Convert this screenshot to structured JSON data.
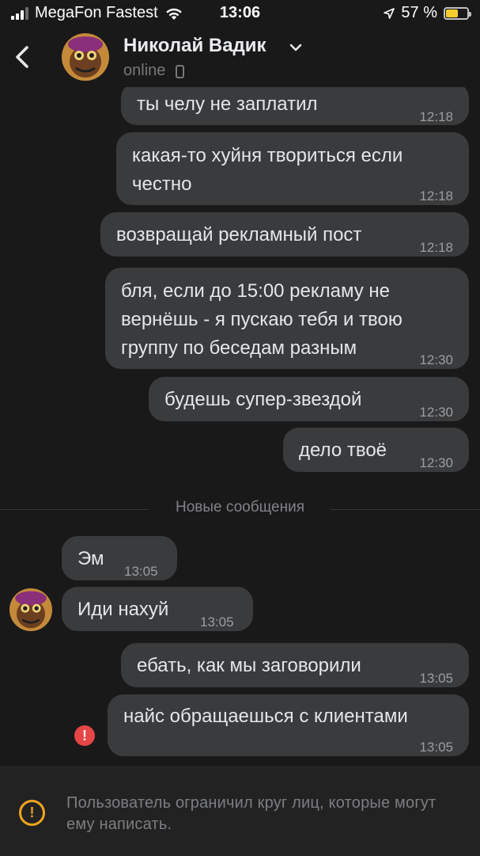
{
  "status_bar": {
    "carrier": "MegaFon Fastest",
    "time": "13:06",
    "battery": "57 %",
    "battery_level": 0.57,
    "battery_color": "#f7cc2d"
  },
  "header": {
    "back_icon": "chevron-left-icon",
    "contact_name": "Николай Вадик",
    "status": "online",
    "status_icon": "mobile-phone-icon"
  },
  "messages": [
    {
      "text": "ты челу не заплатил",
      "time": "12:18",
      "direction": "outgoing"
    },
    {
      "text": "какая-то хуйня твориться если честно",
      "time": "12:18",
      "direction": "outgoing"
    },
    {
      "text": "возвращай рекламный пост",
      "time": "12:18",
      "direction": "outgoing"
    },
    {
      "text": "бля, если до 15:00 рекламу не вернёшь - я пускаю тебя и твою группу по беседам разным",
      "time": "12:30",
      "direction": "outgoing"
    },
    {
      "text": "будешь супер-звездой",
      "time": "12:30",
      "direction": "outgoing"
    },
    {
      "text": "дело твоё",
      "time": "12:30",
      "direction": "outgoing"
    },
    {
      "text": "Эм",
      "time": "13:05",
      "direction": "incoming"
    },
    {
      "text": "Иди нахуй",
      "time": "13:05",
      "direction": "incoming"
    },
    {
      "text": "ебать, как мы заговорили",
      "time": "13:05",
      "direction": "outgoing"
    },
    {
      "text": "найс обращаешься с клиентами",
      "time": "13:05",
      "direction": "outgoing",
      "failed": true
    }
  ],
  "new_messages_divider": "Новые сообщения",
  "footer": {
    "restriction_text": "Пользователь ограничил круг лиц, которые могут ему написать.",
    "icon": "warning-icon"
  },
  "colors": {
    "background": "#19191a",
    "bubble": "#3a3b3c",
    "error": "#e64646",
    "warning": "#f0a51e"
  }
}
